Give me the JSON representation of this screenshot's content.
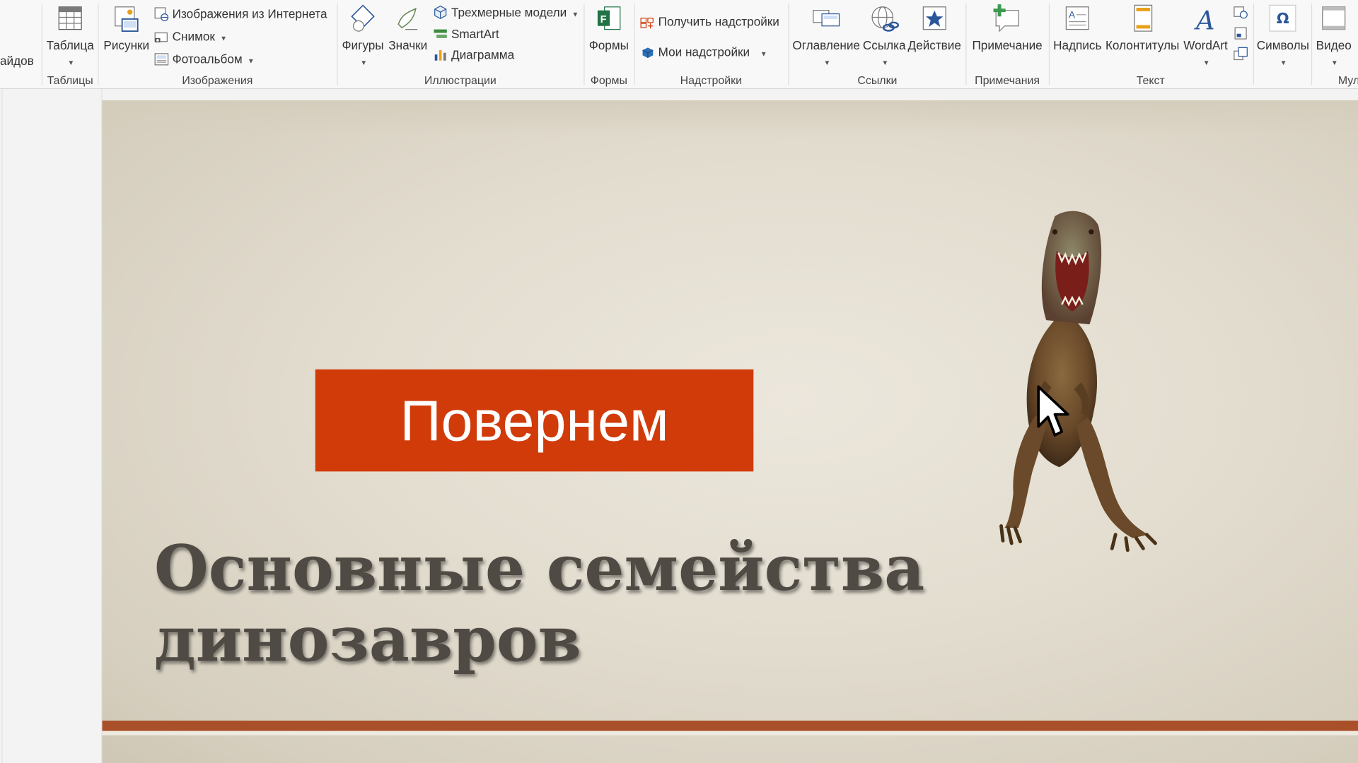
{
  "ribbon": {
    "left_cut_label": "айдов",
    "tables": {
      "group_label": "Таблицы",
      "table_button": "Таблица"
    },
    "images": {
      "group_label": "Изображения",
      "pictures_button": "Рисунки",
      "online_pictures": "Изображения из Интернета",
      "screenshot": "Снимок",
      "photo_album": "Фотоальбом"
    },
    "illustrations": {
      "group_label": "Иллюстрации",
      "shapes_button": "Фигуры",
      "icons_button": "Значки",
      "models_3d": "Трехмерные модели",
      "smartart": "SmartArt",
      "chart": "Диаграмма"
    },
    "forms": {
      "group_label": "Формы",
      "forms_button": "Формы"
    },
    "addins": {
      "group_label": "Надстройки",
      "get_addins": "Получить надстройки",
      "my_addins": "Мои надстройки"
    },
    "links": {
      "group_label": "Ссылки",
      "zoom_button": "Оглавление",
      "link_button": "Ссылка",
      "action_button": "Действие"
    },
    "comments": {
      "group_label": "Примечания",
      "comment_button": "Примечание"
    },
    "text": {
      "group_label": "Текст",
      "textbox_button": "Надпись",
      "header_footer_button": "Колонтитулы",
      "wordart_button": "WordArt"
    },
    "symbols": {
      "symbols_button": "Символы",
      "omega_glyph": "Ω"
    },
    "media": {
      "video_button": "Видео",
      "group_label_cut": "Мул"
    }
  },
  "slide": {
    "button_text": "Повернем",
    "title_line1": "Основные семейства",
    "title_line2": "динозавров"
  },
  "colors": {
    "accent_orange": "#d13b0a",
    "rule_brown": "#a9502a",
    "title_text": "#4f4a43",
    "icon_blue": "#2b579a",
    "forms_green": "#217346"
  },
  "icons": [
    "table-icon",
    "pictures-icon",
    "online-pictures-icon",
    "screenshot-icon",
    "photo-album-icon",
    "shapes-icon",
    "icons-icon",
    "3d-models-icon",
    "smartart-icon",
    "chart-icon",
    "forms-icon",
    "store-icon",
    "my-addins-icon",
    "zoom-icon",
    "link-icon",
    "action-icon",
    "comment-icon",
    "textbox-icon",
    "header-footer-icon",
    "wordart-icon",
    "omega-icon",
    "video-icon",
    "mouse-cursor-icon"
  ]
}
